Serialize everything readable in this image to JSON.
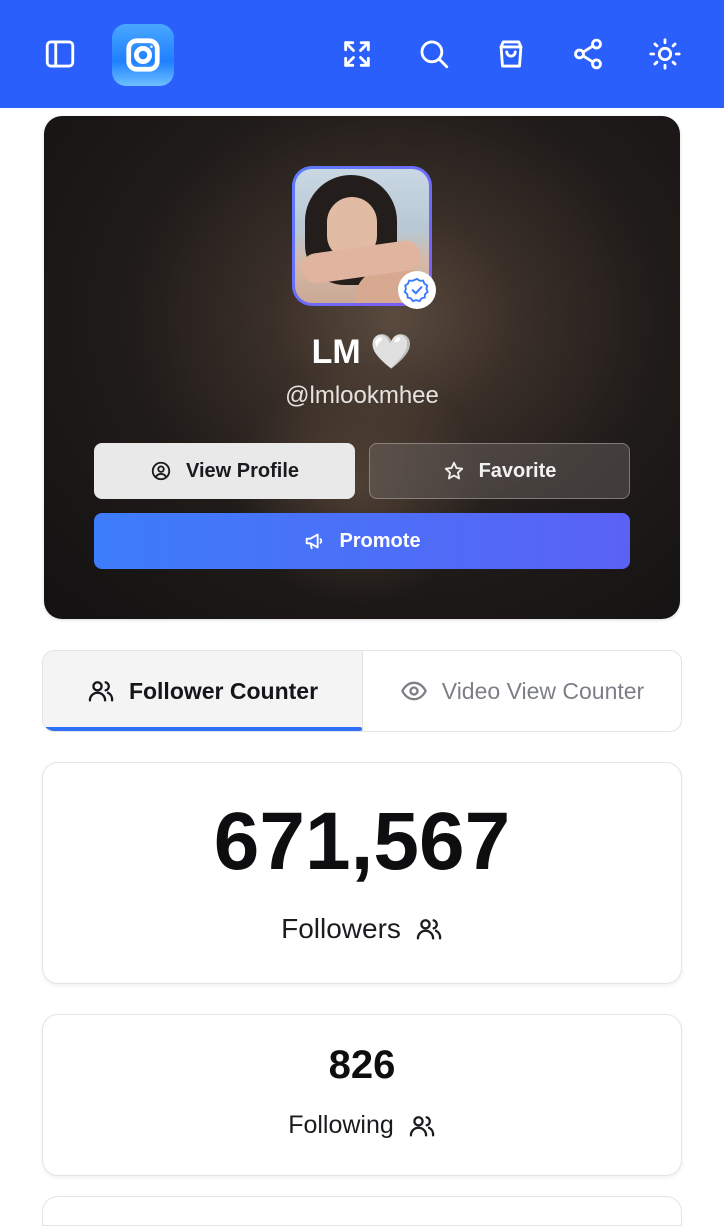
{
  "topbar": {
    "color": "#2a5ffb",
    "icons": [
      "sidebar-icon",
      "instagram-icon",
      "fullscreen-icon",
      "search-icon",
      "shopping-bag-icon",
      "share-icon",
      "sun-icon"
    ]
  },
  "profile": {
    "display_name": "LM 🤍",
    "handle": "@lmlookmhee",
    "verified": true
  },
  "actions": {
    "view_profile_label": "View Profile",
    "favorite_label": "Favorite",
    "promote_label": "Promote"
  },
  "tabs": [
    {
      "label": "Follower Counter",
      "active": true,
      "icon": "users-icon"
    },
    {
      "label": "Video View Counter",
      "active": false,
      "icon": "eye-icon"
    }
  ],
  "stats": {
    "followers_value": "671,567",
    "followers_label": "Followers",
    "following_value": "826",
    "following_label": "Following"
  },
  "colors": {
    "accent": "#2f6ef7",
    "promote_gradient_start": "#3d7dfb",
    "promote_gradient_end": "#5a62f5"
  }
}
